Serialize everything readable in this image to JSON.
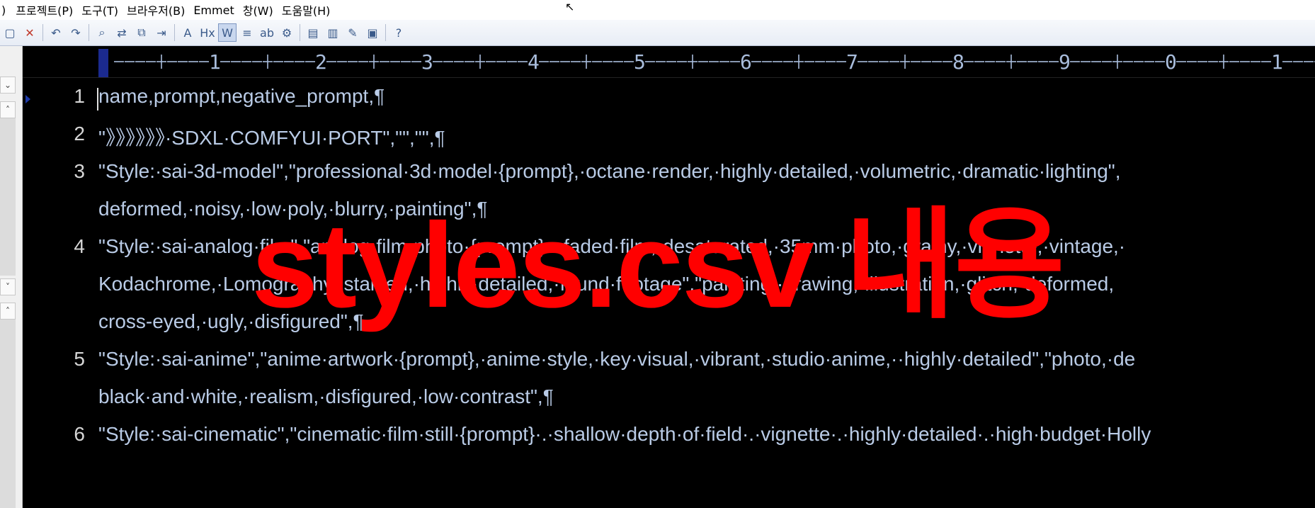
{
  "menu": {
    "items": [
      ")",
      "프로젝트(P)",
      "도구(T)",
      "브라우저(B)",
      "Emmet",
      "창(W)",
      "도움말(H)"
    ]
  },
  "toolbar": {
    "buttons": [
      {
        "name": "unknown-icon",
        "glyph": "▢"
      },
      {
        "name": "close-file-icon",
        "glyph": "✕"
      },
      {
        "name": "undo-icon",
        "glyph": "↶"
      },
      {
        "name": "redo-icon",
        "glyph": "↷"
      },
      {
        "name": "find-icon",
        "glyph": "⌕"
      },
      {
        "name": "replace-icon",
        "glyph": "⇄"
      },
      {
        "name": "find-in-files-icon",
        "glyph": "⧉"
      },
      {
        "name": "jump-icon",
        "glyph": "⇥"
      },
      {
        "name": "font-icon",
        "glyph": "A"
      },
      {
        "name": "heading-icon",
        "glyph": "Hx"
      },
      {
        "name": "word-wrap-icon",
        "glyph": "W"
      },
      {
        "name": "indent-icon",
        "glyph": "≡"
      },
      {
        "name": "spell-check-icon",
        "glyph": "ab"
      },
      {
        "name": "settings-icon",
        "glyph": "⚙"
      },
      {
        "name": "window-icon",
        "glyph": "▤"
      },
      {
        "name": "split-window-icon",
        "glyph": "▥"
      },
      {
        "name": "edit-icon",
        "glyph": "✎"
      },
      {
        "name": "screen-icon",
        "glyph": "▣"
      },
      {
        "name": "help-icon",
        "glyph": "?"
      }
    ],
    "active": "word-wrap-icon"
  },
  "ruler": {
    "numbers": [
      "1",
      "2",
      "3",
      "4",
      "5",
      "6",
      "7",
      "8",
      "9",
      "0",
      "1"
    ]
  },
  "editor": {
    "lines": [
      {
        "number": "1",
        "rows": [
          "name,prompt,negative_prompt,¶"
        ]
      },
      {
        "number": "2",
        "rows": [
          "\"》》》》》》·SDXL·COMFYUI·PORT\",\"\",\"\",¶"
        ]
      },
      {
        "number": "3",
        "rows": [
          "\"Style:·sai-3d-model\",\"professional·3d·model·{prompt},·octane·render,·highly·detailed,·volumetric,·dramatic·lighting\",",
          "deformed,·noisy,·low·poly,·blurry,·painting\",¶"
        ]
      },
      {
        "number": "4",
        "rows": [
          "\"Style:·sai-analog·film\",\"analog·film·photo·{prompt}·.·faded·film,·desaturated,·35mm·photo,·grainy,·vignette,·vintage,·",
          "Kodachrome,·Lomography,·stained,·highly·detailed,·found·footage\",\"painting,·drawing,·illustration,·glitch,·deformed,",
          "cross-eyed,·ugly,·disfigured\",¶"
        ]
      },
      {
        "number": "5",
        "rows": [
          "\"Style:·sai-anime\",\"anime·artwork·{prompt},·anime·style,·key·visual,·vibrant,·studio·anime,··highly·detailed\",\"photo,·de",
          "black·and·white,·realism,·disfigured,·low·contrast\",¶"
        ]
      },
      {
        "number": "6",
        "rows": [
          "\"Style:·sai-cinematic\",\"cinematic·film·still·{prompt}·.·shallow·depth·of·field·.·vignette·.·highly·detailed·.·high·budget·Holly"
        ]
      }
    ]
  },
  "overlay": {
    "text": "styles.csv 내용",
    "color": "#ff0000"
  },
  "colors": {
    "editor_bg": "#000000",
    "text": "#b9cbe6",
    "ruler_text": "#a9bddc",
    "line_number": "#d6d6d6"
  }
}
